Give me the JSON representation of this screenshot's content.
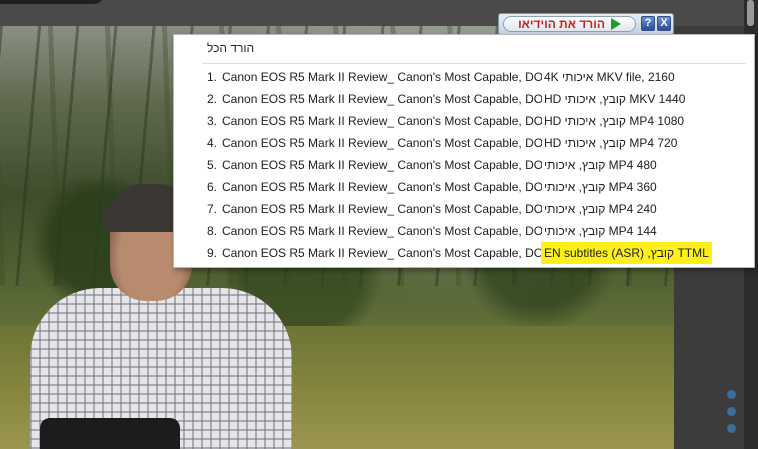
{
  "downloader": {
    "button_label": "הורד את הוידיאו",
    "help_label": "?",
    "close_label": "X"
  },
  "menu": {
    "header": "הורד הכל",
    "items": [
      {
        "num": "1.",
        "title": "Canon EOS R5 Mark II Review_ Canon's Most Capable, DO-...",
        "format": "MKV file, 2160 איכותי 4K"
      },
      {
        "num": "2.",
        "title": "Canon EOS R5 Mark II Review_ Canon's Most Capable, DO-...",
        "format": "MKV 1440 קובץ, איכותי HD"
      },
      {
        "num": "3.",
        "title": "Canon EOS R5 Mark II Review_ Canon's Most Capable, DO-...",
        "format": "MP4 1080 קובץ, איכותי HD"
      },
      {
        "num": "4.",
        "title": "Canon EOS R5 Mark II Review_ Canon's Most Capable, DO-...",
        "format": "MP4 720 קובץ, איכותי HD"
      },
      {
        "num": "5.",
        "title": "Canon EOS R5 Mark II Review_ Canon's Most Capable, DO-...",
        "format": "MP4 480 קובץ, איכותי"
      },
      {
        "num": "6.",
        "title": "Canon EOS R5 Mark II Review_ Canon's Most Capable, DO-...",
        "format": "MP4 360 קובץ, איכותי"
      },
      {
        "num": "7.",
        "title": "Canon EOS R5 Mark II Review_ Canon's Most Capable, DO-...",
        "format": "MP4 240 קובץ, איכותי"
      },
      {
        "num": "8.",
        "title": "Canon EOS R5 Mark II Review_ Canon's Most Capable, DO-...",
        "format": "MP4 144 קובץ, איכותי"
      },
      {
        "num": "9.",
        "title": "Canon EOS R5 Mark II Review_ Canon's Most Capable, DO-...",
        "format": "TTML קובץ, EN subtitles (ASR)",
        "highlighted": true
      }
    ]
  },
  "colors": {
    "highlight": "#ffef1a",
    "downloader_text": "#c82020",
    "play_icon": "#1f9d2a"
  }
}
